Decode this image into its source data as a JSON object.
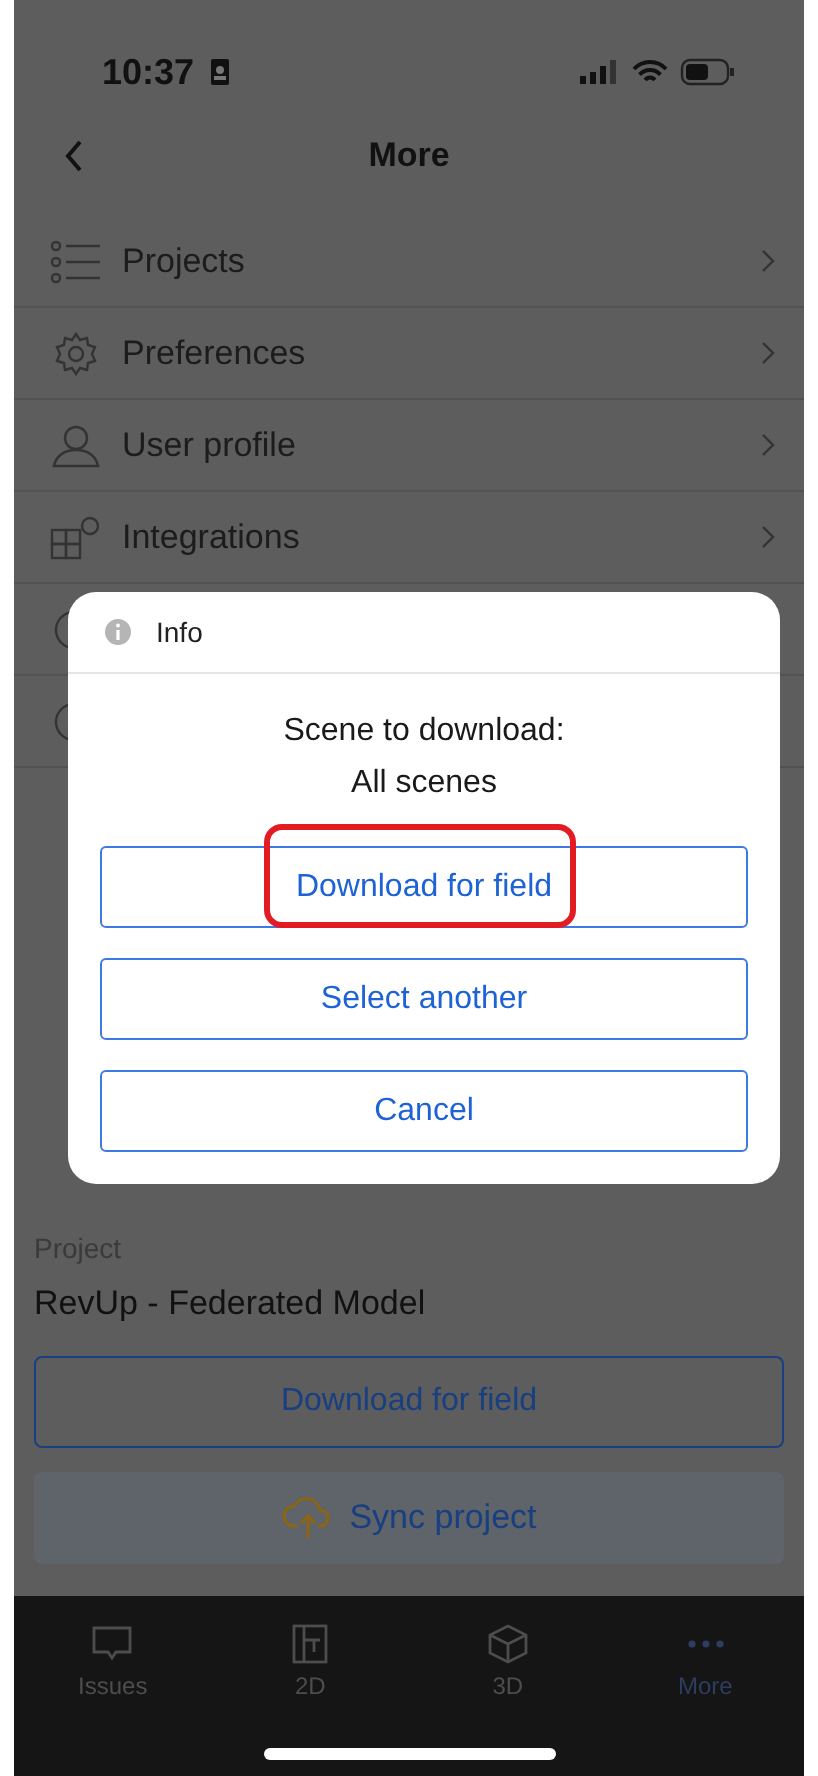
{
  "status_bar": {
    "time": "10:37"
  },
  "header": {
    "title": "More"
  },
  "menu": [
    {
      "kind": "item",
      "label": "Projects"
    },
    {
      "kind": "item",
      "label": "Preferences"
    },
    {
      "kind": "item",
      "label": "User profile"
    },
    {
      "kind": "item",
      "label": "Integrations"
    },
    {
      "kind": "covered"
    },
    {
      "kind": "covered"
    }
  ],
  "project": {
    "label": "Project",
    "name": "RevUp - Federated Model",
    "download_button": "Download for field",
    "sync_button": "Sync project"
  },
  "tab_bar": [
    {
      "label": "Issues",
      "selected": false
    },
    {
      "label": "2D",
      "selected": false
    },
    {
      "label": "3D",
      "selected": false
    },
    {
      "label": "More",
      "selected": true
    }
  ],
  "dialog": {
    "title": "Info",
    "message": [
      "Scene to download:",
      "All scenes"
    ],
    "buttons": [
      {
        "label": "Download for field",
        "highlighted": true
      },
      {
        "label": "Select another",
        "highlighted": false
      },
      {
        "label": "Cancel",
        "highlighted": false
      }
    ]
  }
}
